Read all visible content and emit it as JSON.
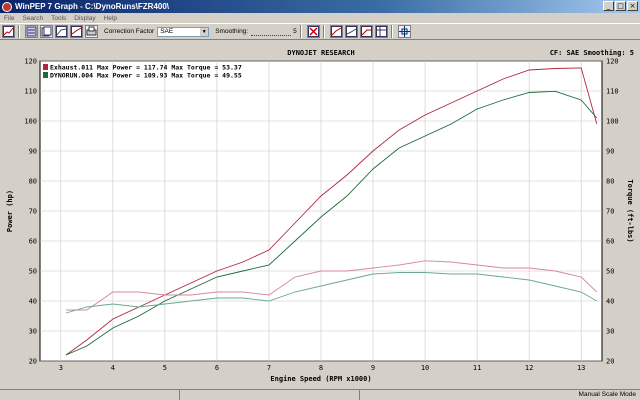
{
  "window": {
    "title": "WinPEP 7  Graph - C:\\DynoRuns\\FZR400\\",
    "minimize": "_",
    "maximize": "□",
    "close": "×"
  },
  "menu": [
    "File",
    "Search",
    "Tools",
    "Display",
    "Help"
  ],
  "toolbar": {
    "correction_label": "Correction Factor",
    "correction_value": "SAE",
    "smoothing_label": "Smoothing:",
    "smoothing_value": "5"
  },
  "status": {
    "mode": "Manual Scale Mode"
  },
  "colors": {
    "power_run1": "#b0283c",
    "power_run2": "#1e6a3a",
    "torque_run1": "#d58a96",
    "torque_run2": "#6aa890"
  },
  "chart_data": {
    "type": "line",
    "title": "DYNOJET RESEARCH",
    "header_right": "CF: SAE  Smoothing: 5",
    "xlabel": "Engine Speed (RPM x1000)",
    "ylabel": "Power (hp)",
    "y2label": "Torque (ft-lbs)",
    "xlim": [
      2.6,
      13.4
    ],
    "ylim": [
      20,
      120
    ],
    "y2lim": [
      20,
      120
    ],
    "x_ticks": [
      3,
      4,
      5,
      6,
      7,
      8,
      9,
      10,
      11,
      12,
      13
    ],
    "y_ticks": [
      20,
      30,
      40,
      50,
      60,
      70,
      80,
      90,
      100,
      110,
      120
    ],
    "grid": true,
    "legend": [
      "Exhaust.011 Max Power = 117.74 Max Torque = 53.37",
      "DYNORUN.004 Max Power = 109.93 Max Torque = 49.55"
    ],
    "series": [
      {
        "name": "Exhaust.011 Max Power = 117.74 Max Torque = 53.37",
        "axis": "left",
        "x": [
          3.1,
          3.5,
          4.0,
          4.5,
          5.0,
          5.5,
          6.0,
          6.5,
          7.0,
          7.5,
          8.0,
          8.5,
          9.0,
          9.5,
          10.0,
          10.5,
          11.0,
          11.5,
          12.0,
          12.5,
          13.0,
          13.3
        ],
        "values": [
          22,
          27,
          34,
          38,
          42,
          46,
          50,
          53,
          57,
          66,
          75,
          82,
          90,
          97,
          102,
          106,
          110,
          114,
          117,
          117.5,
          117.7,
          99
        ]
      },
      {
        "name": "DYNORUN.004 Max Power = 109.93 Max Torque = 49.55",
        "axis": "left",
        "x": [
          3.1,
          3.5,
          4.0,
          4.5,
          5.0,
          5.5,
          6.0,
          6.5,
          7.0,
          7.5,
          8.0,
          8.5,
          9.0,
          9.5,
          10.0,
          10.5,
          11.0,
          11.5,
          12.0,
          12.5,
          13.0,
          13.3
        ],
        "values": [
          22,
          25,
          31,
          35,
          40,
          44,
          48,
          50,
          52,
          60,
          68,
          75,
          84,
          91,
          95,
          99,
          104,
          107,
          109.5,
          109.9,
          107,
          101
        ]
      },
      {
        "name": "Exhaust.011 torque",
        "axis": "right",
        "x": [
          3.1,
          3.5,
          4.0,
          4.5,
          5.0,
          5.5,
          6.0,
          6.5,
          7.0,
          7.5,
          8.0,
          8.5,
          9.0,
          9.5,
          10.0,
          10.5,
          11.0,
          11.5,
          12.0,
          12.5,
          13.0,
          13.3
        ],
        "values": [
          37,
          37,
          43,
          43,
          42,
          42,
          43,
          43,
          42,
          48,
          50,
          50,
          51,
          52,
          53.4,
          53,
          52,
          51,
          51,
          50,
          48,
          43
        ]
      },
      {
        "name": "DYNORUN.004 torque",
        "axis": "right",
        "x": [
          3.1,
          3.5,
          4.0,
          4.5,
          5.0,
          5.5,
          6.0,
          6.5,
          7.0,
          7.5,
          8.0,
          8.5,
          9.0,
          9.5,
          10.0,
          10.5,
          11.0,
          11.5,
          12.0,
          12.5,
          13.0,
          13.3
        ],
        "values": [
          36,
          38,
          39,
          38,
          39,
          40,
          41,
          41,
          40,
          43,
          45,
          47,
          49,
          49.5,
          49.5,
          49,
          49,
          48,
          47,
          45,
          43,
          40
        ]
      }
    ]
  }
}
